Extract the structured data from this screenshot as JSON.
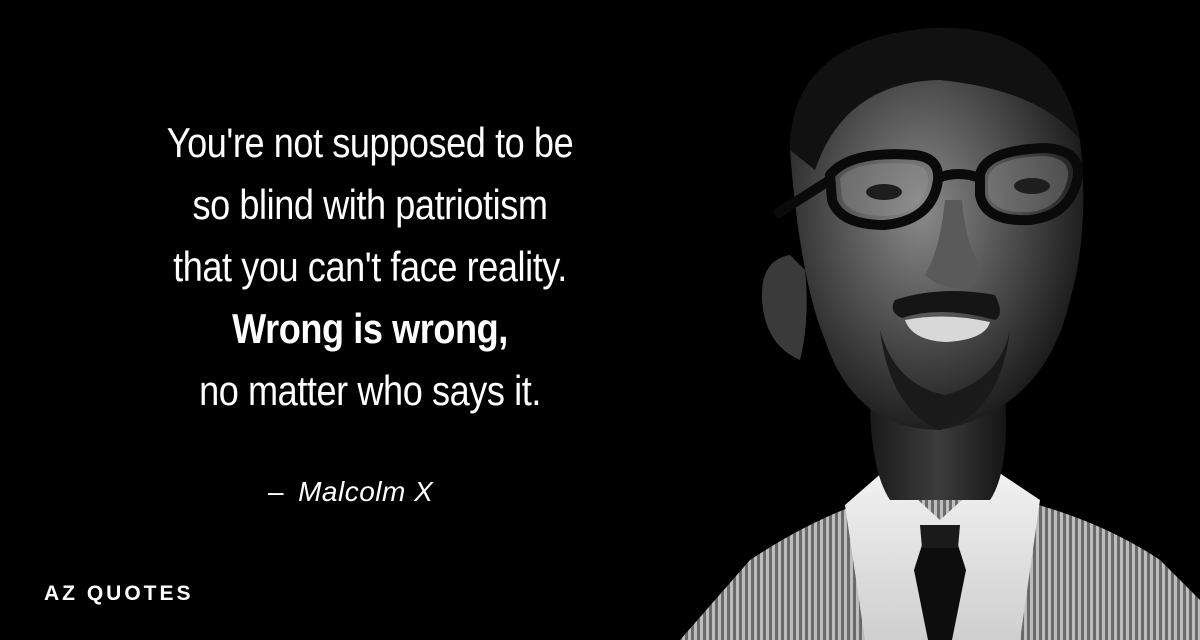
{
  "quote": {
    "lines": [
      "You're not supposed to be",
      "so blind with patriotism",
      "that you can't face reality.",
      "Wrong is wrong,",
      "no matter who says it."
    ],
    "author_dash": "–",
    "author": "Malcolm X"
  },
  "brand": {
    "name": "AZ QUOTES"
  },
  "portrait": {
    "subject_icon": "man-portrait-photo"
  },
  "colors": {
    "background": "#000000",
    "text": "#ffffff"
  }
}
